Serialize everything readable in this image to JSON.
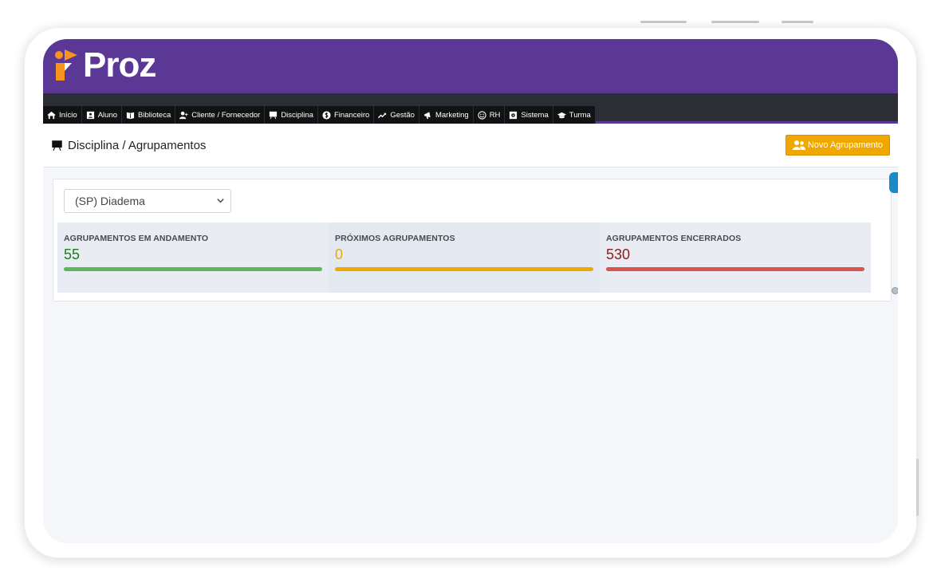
{
  "brand": {
    "name": "Proz"
  },
  "nav": {
    "items": [
      {
        "label": "Início",
        "icon": "home-icon"
      },
      {
        "label": "Aluno",
        "icon": "id-card-icon"
      },
      {
        "label": "Biblioteca",
        "icon": "book-icon"
      },
      {
        "label": "Cliente / Fornecedor",
        "icon": "user-plus-icon"
      },
      {
        "label": "Disciplina",
        "icon": "chalkboard-icon"
      },
      {
        "label": "Financeiro",
        "icon": "dollar-circle-icon"
      },
      {
        "label": "Gestão",
        "icon": "trend-up-icon"
      },
      {
        "label": "Marketing",
        "icon": "megaphone-icon"
      },
      {
        "label": "RH",
        "icon": "smile-icon"
      },
      {
        "label": "Sistema",
        "icon": "gear-box-icon"
      },
      {
        "label": "Turma",
        "icon": "graduation-cap-icon"
      }
    ]
  },
  "page": {
    "title": "Disciplina / Agrupamentos",
    "title_icon": "chalkboard-icon",
    "new_button": {
      "label": "Novo Agrupamento",
      "icon": "users-icon"
    }
  },
  "filter": {
    "selected": "(SP) Diadema"
  },
  "stats": [
    {
      "label": "AGRUPAMENTOS EM ANDAMENTO",
      "value": "55",
      "color": "#1a7f1a",
      "bar_color": "#5cb85c",
      "fill": 1.0
    },
    {
      "label": "PRÓXIMOS AGRUPAMENTOS",
      "value": "0",
      "color": "#f0a700",
      "bar_color": "#f0a700",
      "fill": 1.0
    },
    {
      "label": "AGRUPAMENTOS ENCERRADOS",
      "value": "530",
      "color": "#8b1c1c",
      "bar_color": "#d9534f",
      "fill": 1.0
    }
  ],
  "colors": {
    "header": "#5b3896",
    "nav": "#111214",
    "accent": "#f0a700",
    "logo_orange": "#f7941d"
  }
}
